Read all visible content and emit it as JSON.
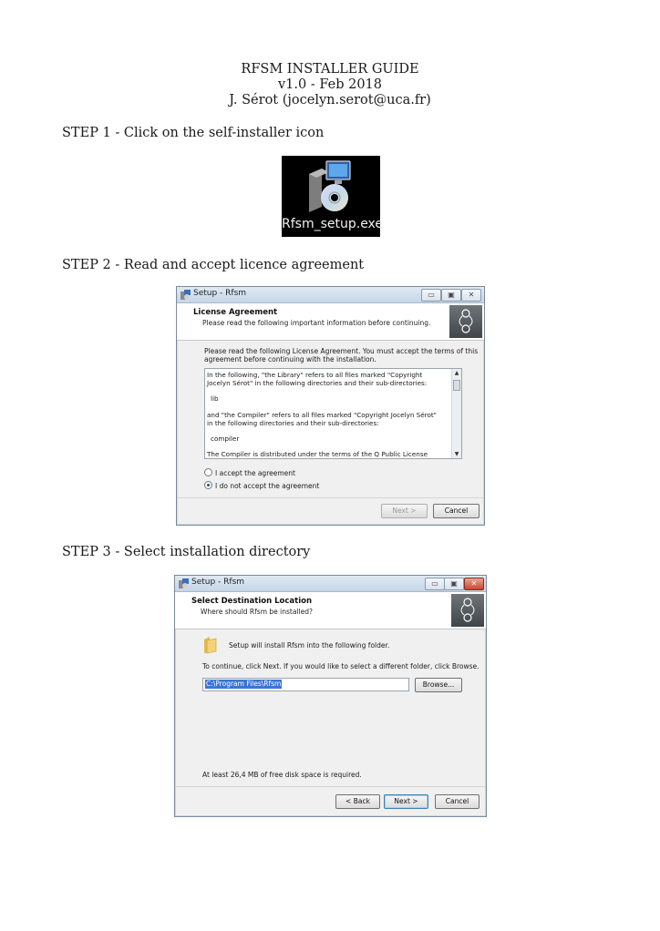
{
  "header": {
    "title": "RFSM INSTALLER GUIDE",
    "version": "v1.0 - Feb 2018",
    "author": "J. Sérot (jocelyn.serot@uca.fr)"
  },
  "steps": [
    {
      "heading": "STEP 1 - Click on the self-installer icon"
    },
    {
      "heading": "STEP 2 - Read and accept licence agreement"
    },
    {
      "heading": "STEP 3 - Select installation directory"
    }
  ],
  "installer": {
    "label": "Rfsm_setup.exe",
    "icon": "setup-disc-icon"
  },
  "window_title": "Setup - Rfsm",
  "licence_dialog": {
    "header_title": "License Agreement",
    "header_subtitle": "Please read the following important information before continuing.",
    "intro_line1": "Please read the following License Agreement. You must accept the terms of this",
    "intro_line2": "agreement before continuing with the installation.",
    "licence_lines": [
      "In the following, \"the Library\" refers to all files marked \"Copyright",
      "Jocelyn Sérot\" in the following directories and their sub-directories:",
      "lib",
      "and \"the Compiler\" refers to all files marked \"Copyright Jocelyn Sérot\"",
      "in the following directories and their sub-directories:",
      "compiler",
      "The Compiler is distributed under the terms of the Q Public License"
    ],
    "accept_label": "I accept the agreement",
    "decline_label": "I do not accept the agreement",
    "selected_option": "decline",
    "next_label": "Next >",
    "cancel_label": "Cancel"
  },
  "directory_dialog": {
    "header_title": "Select Destination Location",
    "header_subtitle": "Where should Rfsm be installed?",
    "info_text": "Setup will install Rfsm into the following folder.",
    "instruction": "To continue, click Next. If you would like to select a different folder, click Browse.",
    "directory_value": "C:\\Program Files\\Rfsm",
    "browse_label": "Browse...",
    "disk_space": "At least 26,4 MB of free disk space is required.",
    "back_label": "< Back",
    "next_label": "Next >",
    "cancel_label": "Cancel"
  }
}
